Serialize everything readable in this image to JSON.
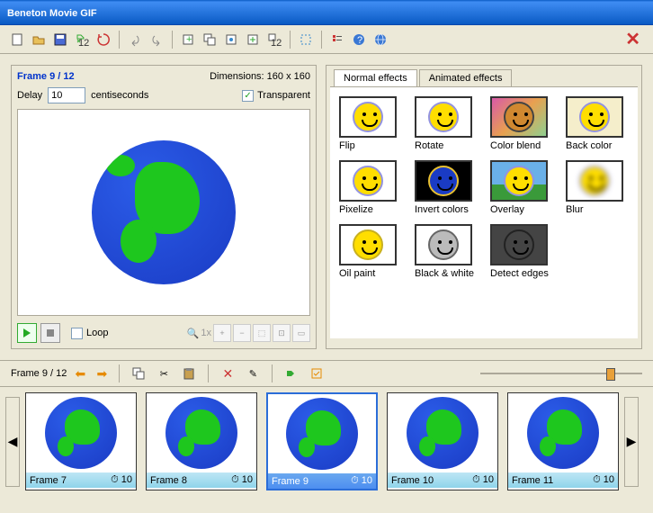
{
  "window": {
    "title": "Beneton Movie GIF"
  },
  "preview": {
    "frame_indicator": "Frame 9 / 12",
    "dimensions": "Dimensions: 160 x 160",
    "delay_label": "Delay",
    "delay_value": "10",
    "delay_unit": "centiseconds",
    "transparent_label": "Transparent",
    "transparent_checked": true,
    "loop_label": "Loop",
    "loop_checked": false,
    "zoom_label": "1x"
  },
  "effects": {
    "tabs": [
      {
        "label": "Normal effects",
        "active": true
      },
      {
        "label": "Animated effects",
        "active": false
      }
    ],
    "items": [
      {
        "label": "Flip",
        "variant": "plain"
      },
      {
        "label": "Rotate",
        "variant": "plain"
      },
      {
        "label": "Color blend",
        "variant": "gradient"
      },
      {
        "label": "Back color",
        "variant": "cream"
      },
      {
        "label": "Pixelize",
        "variant": "plain"
      },
      {
        "label": "Invert colors",
        "variant": "invert"
      },
      {
        "label": "Overlay",
        "variant": "overlay"
      },
      {
        "label": "Blur",
        "variant": "blur"
      },
      {
        "label": "Oil paint",
        "variant": "oil"
      },
      {
        "label": "Black & white",
        "variant": "bw"
      },
      {
        "label": "Detect edges",
        "variant": "edges"
      }
    ]
  },
  "timeline": {
    "indicator": "Frame 9 / 12",
    "frames": [
      {
        "label": "Frame 7",
        "delay": "10",
        "selected": false
      },
      {
        "label": "Frame 8",
        "delay": "10",
        "selected": false
      },
      {
        "label": "Frame 9",
        "delay": "10",
        "selected": true
      },
      {
        "label": "Frame 10",
        "delay": "10",
        "selected": false
      },
      {
        "label": "Frame 11",
        "delay": "10",
        "selected": false
      }
    ]
  },
  "toolbar_icons": [
    "new-file",
    "open-file",
    "save-file",
    "export-batch",
    "reload",
    "",
    "undo",
    "redo",
    "",
    "add-frame",
    "duplicate-frame",
    "frame-props",
    "move-frame",
    "batch-settings",
    "",
    "crop",
    "",
    "list-view",
    "help",
    "web"
  ]
}
